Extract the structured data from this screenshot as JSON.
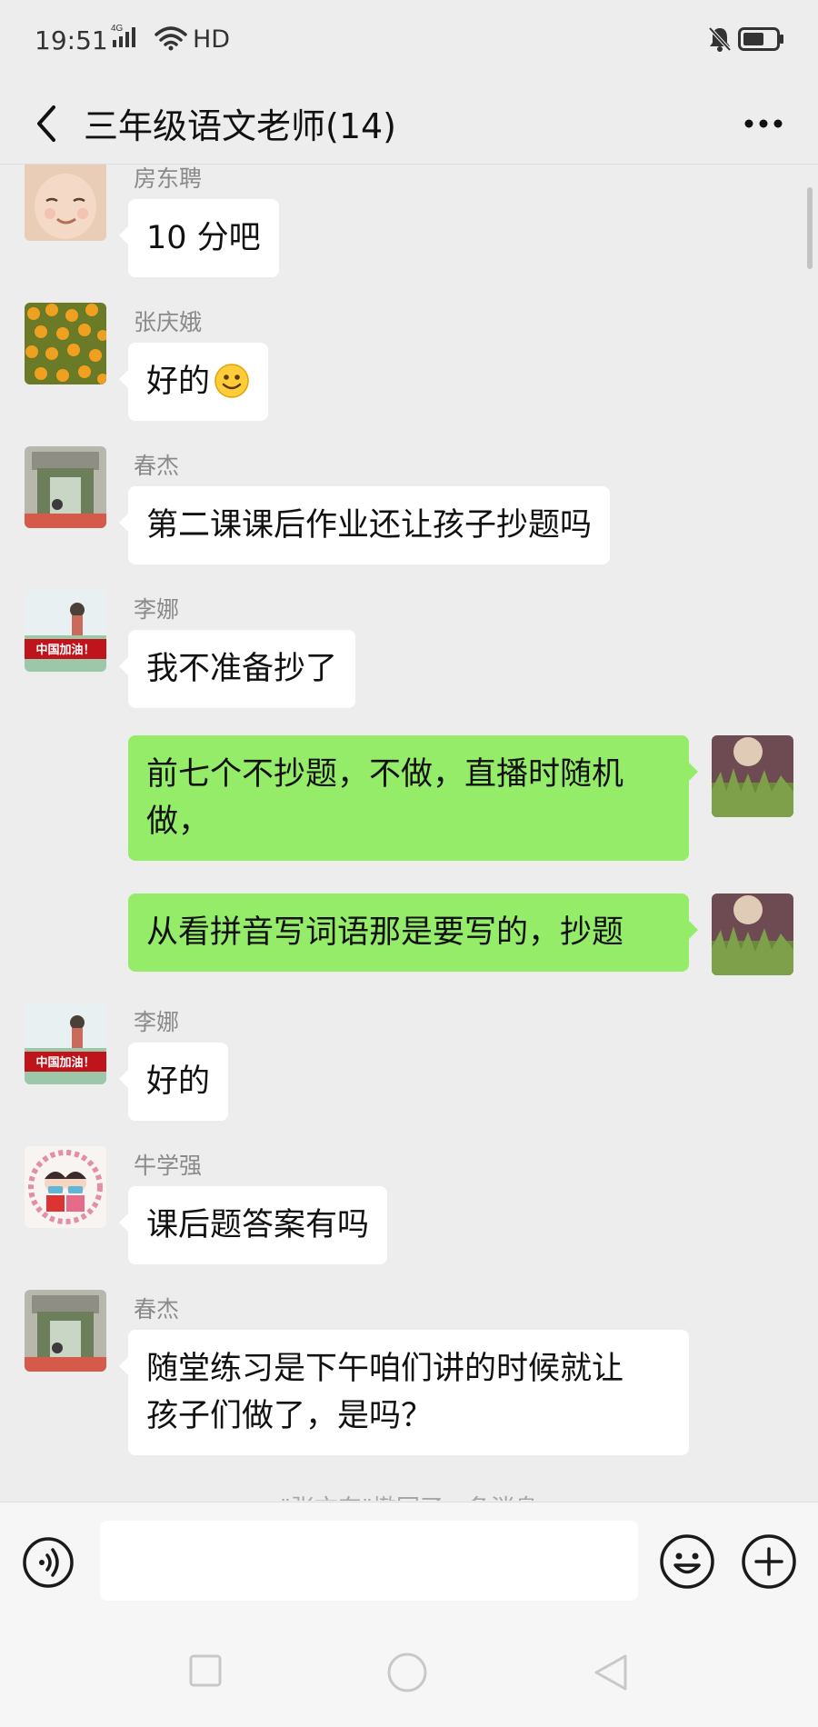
{
  "status_bar": {
    "time": "19:51",
    "network": "4G",
    "hd": "HD"
  },
  "header": {
    "title": "三年级语文老师(14)"
  },
  "messages": [
    {
      "sender": "房东聘",
      "text": "10 分吧"
    },
    {
      "sender": "张庆娥",
      "text": "好的"
    },
    {
      "sender": "春杰",
      "text": "第二课课后作业还让孩子抄题吗"
    },
    {
      "sender": "李娜",
      "text": "我不准备抄了",
      "avatar_text": "中国加油！"
    },
    {
      "text": "前七个不抄题，不做，直播时随机\n做，"
    },
    {
      "text": "从看拼音写词语那是要写的，抄题"
    },
    {
      "sender": "李娜",
      "text": "好的",
      "avatar_text": "中国加油！"
    },
    {
      "sender": "牛学强",
      "text": "课后题答案有吗"
    },
    {
      "sender": "春杰",
      "text": "随堂练习是下午咱们讲的时候就让\n孩子们做了，是吗？"
    }
  ],
  "system_note": "\"张文东\"撤回了一条消息",
  "colors": {
    "background": "#ededed",
    "outgoing_bubble": "#95ec69",
    "incoming_bubble": "#ffffff"
  },
  "icons": {
    "back": "chevron-left-icon",
    "more": "more-icon",
    "voice": "voice-icon",
    "emoji": "emoji-icon",
    "plus": "plus-icon"
  }
}
